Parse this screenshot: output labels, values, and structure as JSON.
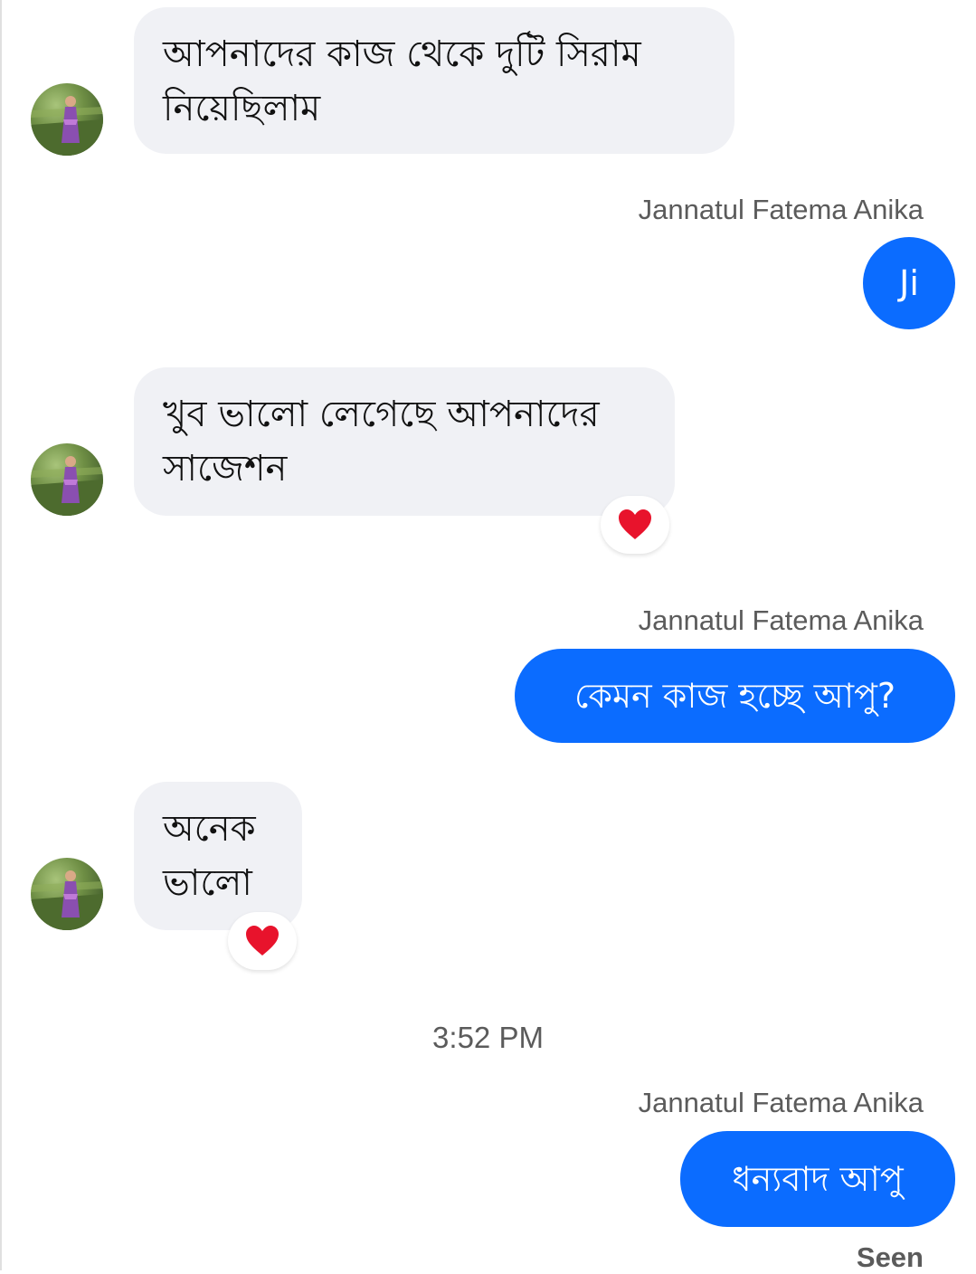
{
  "conversation": {
    "messages": [
      {
        "direction": "in",
        "text": "আপনাদের কাজ থেকে দুটি সিরাম নিয়েছিলাম",
        "reaction": ""
      },
      {
        "direction": "out",
        "sender": "Jannatul Fatema Anika",
        "text": "Ji"
      },
      {
        "direction": "in",
        "text": "খুব ভালো লেগেছে আপনাদের সাজেশন",
        "reaction": "heart"
      },
      {
        "direction": "out",
        "sender": "Jannatul Fatema Anika",
        "text": "কেমন কাজ হচ্ছে আপু?"
      },
      {
        "direction": "in",
        "text": "অনেক ভালো",
        "reaction": "heart"
      },
      {
        "direction": "out",
        "sender": "Jannatul Fatema Anika",
        "text": "ধন্যবাদ আপু"
      }
    ],
    "timestamp": "3:52 PM",
    "status": "Seen"
  },
  "colors": {
    "outgoing_bubble": "#0b6cff",
    "incoming_bubble": "#f0f1f5",
    "reaction_heart": "#e8132c"
  },
  "icons": {
    "reaction": "heart-icon",
    "avatar": "contact-avatar-photo"
  }
}
